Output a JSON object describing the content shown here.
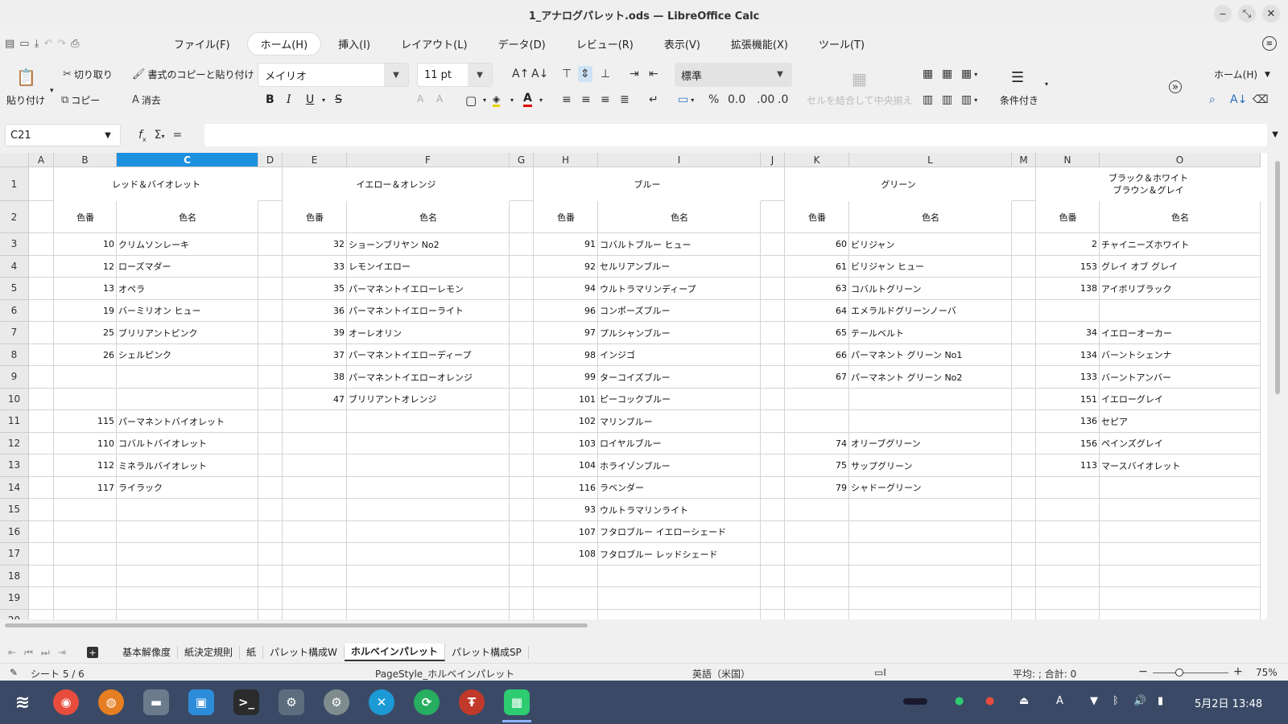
{
  "window": {
    "title": "1_アナログパレット.ods — LibreOffice Calc",
    "minimize": "‒",
    "restore": "⤡",
    "close": "✕"
  },
  "menu": {
    "items": [
      "ファイル(F)",
      "ホーム(H)",
      "挿入(I)",
      "レイアウト(L)",
      "データ(D)",
      "レビュー(R)",
      "表示(V)",
      "拡張機能(X)",
      "ツール(T)"
    ],
    "active_index": 1
  },
  "ribbon": {
    "paste": "貼り付け",
    "cut": "切り取り",
    "copy": "コピー",
    "clone": "書式のコピーと貼り付け",
    "clear": "消去",
    "font_name": "メイリオ",
    "font_size": "11 pt",
    "para_style": "標準",
    "merge_center": "セルを結合して中央揃え",
    "conditional": "条件付き",
    "home_menu": "ホーム(H)",
    "bold": "B",
    "italic": "I",
    "underline": "U",
    "strike": "S"
  },
  "formula_bar": {
    "name_box": "C21",
    "fx": "f",
    "sigma": "Σ",
    "equals": "="
  },
  "columns": [
    {
      "label": "A",
      "w": 31
    },
    {
      "label": "B",
      "w": 78
    },
    {
      "label": "C",
      "w": 176
    },
    {
      "label": "D",
      "w": 30
    },
    {
      "label": "E",
      "w": 80
    },
    {
      "label": "F",
      "w": 202
    },
    {
      "label": "G",
      "w": 30
    },
    {
      "label": "H",
      "w": 80
    },
    {
      "label": "I",
      "w": 202
    },
    {
      "label": "J",
      "w": 30
    },
    {
      "label": "K",
      "w": 80
    },
    {
      "label": "L",
      "w": 202
    },
    {
      "label": "M",
      "w": 30
    },
    {
      "label": "N",
      "w": 79
    },
    {
      "label": "O",
      "w": 200
    }
  ],
  "selected_column": "C",
  "rows": [
    "1",
    "2",
    "3",
    "4",
    "5",
    "6",
    "7",
    "8",
    "9",
    "10",
    "11",
    "12",
    "13",
    "14",
    "15",
    "16",
    "17",
    "18",
    "19",
    "20"
  ],
  "groups": [
    {
      "title": "レッド＆バイオレット",
      "num_col": 1,
      "name_col": 2
    },
    {
      "title": "イエロー＆オレンジ",
      "num_col": 4,
      "name_col": 5
    },
    {
      "title": "ブルー",
      "num_col": 7,
      "name_col": 8
    },
    {
      "title": "グリーン",
      "num_col": 10,
      "name_col": 11
    },
    {
      "title_lines": [
        "ブラック＆ホワイト",
        "ブラウン＆グレイ"
      ],
      "num_col": 13,
      "name_col": 14
    }
  ],
  "subheaders": {
    "number": "色番",
    "name": "色名"
  },
  "cells": {
    "red": [
      {
        "row": 3,
        "n": "10",
        "name": "クリムソンレーキ"
      },
      {
        "row": 4,
        "n": "12",
        "name": "ローズマダー"
      },
      {
        "row": 5,
        "n": "13",
        "name": "オペラ"
      },
      {
        "row": 6,
        "n": "19",
        "name": "バーミリオン ヒュー"
      },
      {
        "row": 7,
        "n": "25",
        "name": "ブリリアントピンク"
      },
      {
        "row": 8,
        "n": "26",
        "name": "シェルピンク"
      },
      {
        "row": 11,
        "n": "115",
        "name": "パーマネントバイオレット"
      },
      {
        "row": 12,
        "n": "110",
        "name": "コバルトバイオレット"
      },
      {
        "row": 13,
        "n": "112",
        "name": "ミネラルバイオレット"
      },
      {
        "row": 14,
        "n": "117",
        "name": "ライラック"
      }
    ],
    "yellow": [
      {
        "row": 3,
        "n": "32",
        "name": "ショーンブリヤン No2"
      },
      {
        "row": 4,
        "n": "33",
        "name": "レモンイエロー"
      },
      {
        "row": 5,
        "n": "35",
        "name": "パーマネントイエローレモン"
      },
      {
        "row": 6,
        "n": "36",
        "name": "パーマネントイエローライト"
      },
      {
        "row": 7,
        "n": "39",
        "name": "オーレオリン"
      },
      {
        "row": 8,
        "n": "37",
        "name": "パーマネントイエローディープ"
      },
      {
        "row": 9,
        "n": "38",
        "name": "パーマネントイエローオレンジ"
      },
      {
        "row": 10,
        "n": "47",
        "name": "ブリリアントオレンジ"
      }
    ],
    "blue": [
      {
        "row": 3,
        "n": "91",
        "name": "コバルトブルー ヒュー"
      },
      {
        "row": 4,
        "n": "92",
        "name": "セルリアンブルー"
      },
      {
        "row": 5,
        "n": "94",
        "name": "ウルトラマリンディープ"
      },
      {
        "row": 6,
        "n": "96",
        "name": "コンポーズブルー"
      },
      {
        "row": 7,
        "n": "97",
        "name": "プルシャンブルー"
      },
      {
        "row": 8,
        "n": "98",
        "name": "インジゴ"
      },
      {
        "row": 9,
        "n": "99",
        "name": "ターコイズブルー"
      },
      {
        "row": 10,
        "n": "101",
        "name": "ピーコックブルー"
      },
      {
        "row": 11,
        "n": "102",
        "name": "マリンブルー"
      },
      {
        "row": 12,
        "n": "103",
        "name": "ロイヤルブルー"
      },
      {
        "row": 13,
        "n": "104",
        "name": "ホライゾンブルー"
      },
      {
        "row": 14,
        "n": "116",
        "name": "ラベンダー"
      },
      {
        "row": 15,
        "n": "93",
        "name": "ウルトラマリンライト"
      },
      {
        "row": 16,
        "n": "107",
        "name": "フタロブルー イエローシェード"
      },
      {
        "row": 17,
        "n": "108",
        "name": "フタロブルー レッドシェード"
      }
    ],
    "green": [
      {
        "row": 3,
        "n": "60",
        "name": "ビリジャン"
      },
      {
        "row": 4,
        "n": "61",
        "name": "ビリジャン ヒュー"
      },
      {
        "row": 5,
        "n": "63",
        "name": "コバルトグリーン"
      },
      {
        "row": 6,
        "n": "64",
        "name": "エメラルドグリーンノーバ"
      },
      {
        "row": 7,
        "n": "65",
        "name": "テールベルト"
      },
      {
        "row": 8,
        "n": "66",
        "name": "パーマネント グリーン No1"
      },
      {
        "row": 9,
        "n": "67",
        "name": "パーマネント グリーン No2"
      },
      {
        "row": 12,
        "n": "74",
        "name": "オリーブグリーン"
      },
      {
        "row": 13,
        "n": "75",
        "name": "サップグリーン"
      },
      {
        "row": 14,
        "n": "79",
        "name": "シャドーグリーン"
      }
    ],
    "black": [
      {
        "row": 3,
        "n": "2",
        "name": "チャイニーズホワイト"
      },
      {
        "row": 4,
        "n": "153",
        "name": "グレイ オブ グレイ"
      },
      {
        "row": 5,
        "n": "138",
        "name": "アイボリブラック"
      },
      {
        "row": 7,
        "n": "34",
        "name": "イエローオーカー"
      },
      {
        "row": 8,
        "n": "134",
        "name": "バーントシェンナ"
      },
      {
        "row": 9,
        "n": "133",
        "name": "バーントアンバー"
      },
      {
        "row": 10,
        "n": "151",
        "name": "イエローグレイ"
      },
      {
        "row": 11,
        "n": "136",
        "name": "セピア"
      },
      {
        "row": 12,
        "n": "156",
        "name": "ペインズグレイ"
      },
      {
        "row": 13,
        "n": "113",
        "name": "マースバイオレット"
      }
    ]
  },
  "sheet_tabs": [
    "基本解像度",
    "紙決定規則",
    "紙",
    "パレット構成W",
    "ホルベインパレット",
    "パレット構成SP"
  ],
  "active_sheet": "ホルベインパレット",
  "status": {
    "sheet": "シート 5 / 6",
    "page_style": "PageStyle_ホルベインパレット",
    "language": "英語（米国）",
    "sum": "平均: ; 合計: 0",
    "zoom": "75%",
    "zoom_minus": "−",
    "zoom_plus": "+"
  },
  "taskbar": {
    "date_time": "5月2日 13:48",
    "input": "A"
  }
}
